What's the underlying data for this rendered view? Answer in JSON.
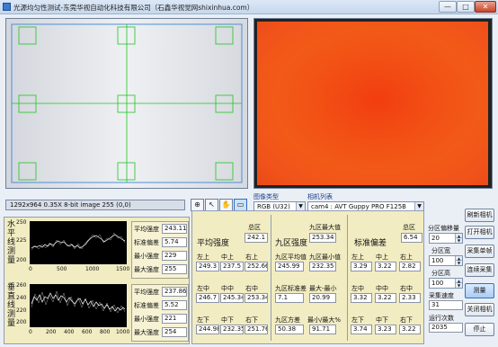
{
  "window": {
    "title": "光源均匀性测试-东莞华视自动化科技有限公司（石鑫华视觉网shixinhua.com）",
    "minimize": "—",
    "maximize": "□",
    "close": "✕"
  },
  "image_info": "1292x964 0.35X 8-bit image 255     (0,0)",
  "tools": [
    "zoom-icon",
    "arrow-icon",
    "hand-icon",
    "fit-icon"
  ],
  "camera": {
    "type_label": "图像类型",
    "type_value": "RGB (U32)",
    "list_label": "相机列表",
    "list_value": "cam4 : AVT Guppy PRO F125B"
  },
  "buttons": {
    "refresh": "刷新相机",
    "open": "打开相机",
    "capture_single": "采集单帧",
    "capture_continuous": "连续采集",
    "measure": "测量",
    "close_camera": "关闭相机",
    "stop": "停止"
  },
  "controls": {
    "tolerance_label": "分区偏移量",
    "tolerance_value": "20",
    "width_label": "分区宽",
    "width_value": "100",
    "height_label": "分区高",
    "height_value": "100",
    "speed_label": "采集速度",
    "speed_value": "31",
    "count_label": "运行次数",
    "count_value": "2035"
  },
  "plots": {
    "horizontal": {
      "label": "水平线测量",
      "ymax": "250",
      "ymin": "200",
      "ymid": "225",
      "xticks": [
        "0",
        "500",
        "1000",
        "1500"
      ],
      "avg_label": "平均强度",
      "avg": "243.11",
      "std_label": "标准偏差",
      "std": "5.74",
      "min_label": "最小强度",
      "min": "229",
      "max_label": "最大强度",
      "max": "255"
    },
    "vertical": {
      "label": "垂直线测量",
      "ymax": "260",
      "ymin": "200",
      "ymid": "220",
      "ymid2": "240",
      "xticks": [
        "0",
        "200",
        "400",
        "600",
        "800",
        "1000"
      ],
      "avg_label": "平均强度",
      "avg": "237.86",
      "std_label": "标准偏差",
      "std": "5.52",
      "min_label": "最小强度",
      "min": "221",
      "max_label": "最大强度",
      "max": "254"
    }
  },
  "stats": {
    "intensity": {
      "title": "平均强度",
      "total_label": "总区",
      "total": "242.1",
      "cells": [
        {
          "label": "左上",
          "value": "249.3"
        },
        {
          "label": "中上",
          "value": "237.5"
        },
        {
          "label": "右上",
          "value": "252.66"
        },
        {
          "label": "左中",
          "value": "246.7"
        },
        {
          "label": "中中",
          "value": "245.34"
        },
        {
          "label": "右中",
          "value": "253.34"
        },
        {
          "label": "左下",
          "value": "244.98"
        },
        {
          "label": "中下",
          "value": "232.35"
        },
        {
          "label": "右下",
          "value": "251.76"
        }
      ]
    },
    "nine": {
      "title": "九区强度",
      "max_label": "九区最大值",
      "max": "253.34",
      "avg_label": "九区平均值",
      "avg": "245.99",
      "min_label": "九区最小值",
      "min": "232.35",
      "std_label": "九区标准差",
      "std": "7.1",
      "range_label": "最大-最小",
      "range": "20.99",
      "var_label": "九区方差",
      "var": "50.38",
      "ratio_label": "最小/最大%",
      "ratio": "91.71"
    },
    "std": {
      "title": "标准偏差",
      "total_label": "总区",
      "total": "6.54",
      "cells": [
        {
          "label": "左上",
          "value": "3.29"
        },
        {
          "label": "中上",
          "value": "3.22"
        },
        {
          "label": "右上",
          "value": "2.82"
        },
        {
          "label": "左中",
          "value": "3.32"
        },
        {
          "label": "中中",
          "value": "3.22"
        },
        {
          "label": "右中",
          "value": "2.33"
        },
        {
          "label": "左下",
          "value": "3.74"
        },
        {
          "label": "中下",
          "value": "3.23"
        },
        {
          "label": "右下",
          "value": "3.22"
        }
      ]
    }
  }
}
